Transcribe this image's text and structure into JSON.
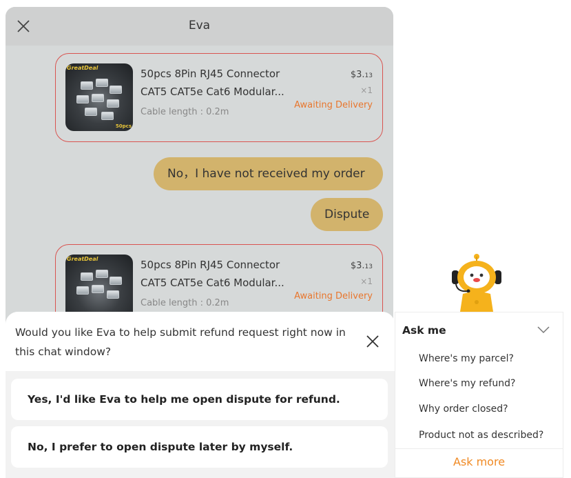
{
  "chat": {
    "title": "Eva",
    "product": {
      "name": "50pcs 8Pin RJ45 Connector CAT5 CAT5e Cat6 Modular...",
      "line1": "50pcs 8Pin RJ45 Connector",
      "line2": "CAT5 CAT5e Cat6 Modular...",
      "attribute": "Cable length : 0.2m",
      "price_main": "$3.",
      "price_cents": "13",
      "quantity": "×1",
      "status": "Awaiting Delivery",
      "image_brand": "GreatDeal",
      "image_qty": "50pcs"
    },
    "messages": [
      {
        "text": "No，I have not received my order"
      },
      {
        "text": "Dispute"
      }
    ]
  },
  "refund_prompt": {
    "question": "Would you like Eva to help submit refund request right now in this chat window?",
    "options": [
      "Yes, I'd like Eva to help me open dispute for refund.",
      "No, I prefer to open dispute later by myself."
    ]
  },
  "ask_me": {
    "title": "Ask me",
    "items": [
      "Where's my parcel?",
      "Where's my refund?",
      "Why order closed?",
      "Product not as described?"
    ],
    "more": "Ask more"
  },
  "colors": {
    "accent_orange": "#f08a24",
    "status_orange": "#e8762d",
    "bubble_gold": "#d2b36c",
    "card_border_red": "#d9534f",
    "mascot_yellow": "#f5b21c"
  },
  "icons": {
    "close": "close-icon",
    "chevron": "chevron-down-icon",
    "mascot": "robot-mascot-icon"
  }
}
